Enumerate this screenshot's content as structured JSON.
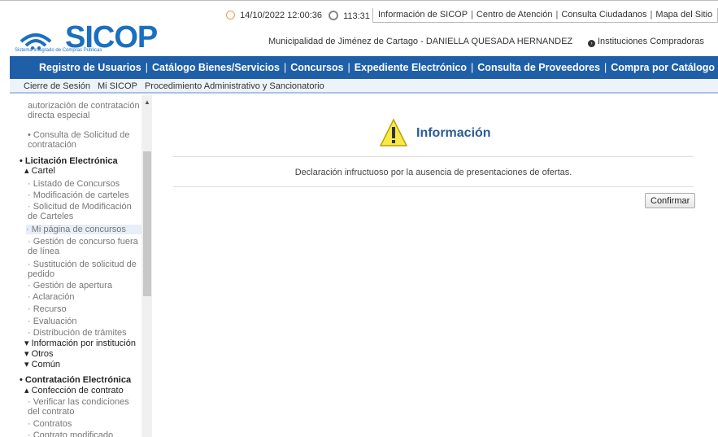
{
  "header": {
    "logo_text": "SICOP",
    "logo_subtitle": "Sistema Integrado de Compras Públicas",
    "datetime": "14/10/2022 12:00:36",
    "session_timer": "113:31",
    "top_links": [
      "Información de SICOP",
      "Centro de Atención",
      "Consulta Ciudadanos",
      "Mapa del Sitio"
    ],
    "user_line": "Municipalidad de Jiménez de Cartago - DANIELLA QUESADA HERNANDEZ",
    "institutions_link": "Instituciones Compradoras"
  },
  "navbar": {
    "items": [
      "Registro de Usuarios",
      "Catálogo Bienes/Servicios",
      "Concursos",
      "Expediente Electrónico",
      "Consulta de Proveedores",
      "Compra por Catálogo"
    ]
  },
  "subnav": {
    "items": [
      "Cierre de Sesión",
      "Mi SICOP",
      "Procedimiento Administrativo y Sancionatorio"
    ]
  },
  "sidebar": {
    "items": [
      {
        "label": "autorización de contratación directa especial",
        "style": "sub"
      },
      {
        "label": "• Consulta de Solicitud de contratación",
        "style": "sub"
      },
      {
        "label": "• Licitación Electrónica",
        "style": "bold"
      },
      {
        "label": "▴ Cartel",
        "style": "dark"
      },
      {
        "label": "· Listado de Concursos",
        "style": "sub"
      },
      {
        "label": "· Modificación de carteles",
        "style": "sub"
      },
      {
        "label": "· Solicitud de Modificación de Carteles",
        "style": "sub"
      },
      {
        "label": "· Mi página de concursos",
        "style": "hl"
      },
      {
        "label": "· Gestión de concurso fuera de línea",
        "style": "sub"
      },
      {
        "label": "· Sustitución de solicitud de pedido",
        "style": "sub"
      },
      {
        "label": "· Gestión de apertura",
        "style": "sub"
      },
      {
        "label": "· Aclaración",
        "style": "sub"
      },
      {
        "label": "· Recurso",
        "style": "sub"
      },
      {
        "label": "· Evaluación",
        "style": "sub"
      },
      {
        "label": "· Distribución de trámites",
        "style": "sub"
      },
      {
        "label": "▾ Información por institución",
        "style": "dark"
      },
      {
        "label": "▾ Otros",
        "style": "dark"
      },
      {
        "label": "▾ Común",
        "style": "dark"
      },
      {
        "label": "• Contratación Electrónica",
        "style": "bold"
      },
      {
        "label": "▴ Confección de contrato",
        "style": "dark"
      },
      {
        "label": "· Verificar las condiciones del contrato",
        "style": "sub"
      },
      {
        "label": "· Contratos",
        "style": "sub"
      },
      {
        "label": "· Contrato modificado",
        "style": "sub"
      }
    ]
  },
  "main": {
    "title": "Información",
    "message": "Declaración infructuoso por la ausencia de presentaciones de ofertas.",
    "confirm_label": "Confirmar"
  },
  "colors": {
    "navbar": "#1f5fa8",
    "brand": "#1a6fc1",
    "title": "#2a5c9a"
  }
}
